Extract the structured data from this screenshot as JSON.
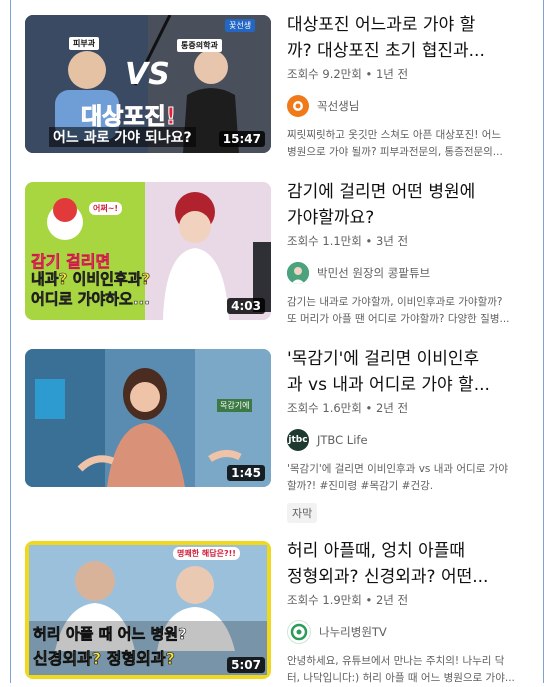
{
  "videos": [
    {
      "title_line1": "대상포진 어느과로 가야 할",
      "title_line2": "까? 대상포진 초기 협진과...",
      "views": "조회수 9.2만회",
      "age": "1년 전",
      "channel": "꼭선생님",
      "desc_line1": "찌릿찌릿하고 옷깃만 스쳐도 아픈 대상포진! 어느",
      "desc_line2": "병원으로 가야 될까? 피부과전문의, 통증전문의...",
      "duration": "15:47",
      "thumb_tag_left": "피부과",
      "thumb_tag_right": "통증의학과",
      "thumb_corner": "꽃선생",
      "thumb_vs": "VS",
      "thumb_big": "대상포진!",
      "thumb_sub": "어느 과로 가야 되나요?",
      "avatar_color": "#f07a1a"
    },
    {
      "title_line1": "감기에 걸리면 어떤 병원에",
      "title_line2": "가야할까요?",
      "views": "조회수 1.1만회",
      "age": "3년 전",
      "channel": "박민선 원장의 콩팥튜브",
      "desc_line1": "감기는 내과로 가야할까, 이비인후과로 가야할까?",
      "desc_line2": "또 머리가 아플 땐 어디로 가야할까? 다양한 질병...",
      "duration": "4:03",
      "thumb_bubble": "어쩌~!",
      "thumb_line1": "감기 걸리면",
      "thumb_line2": "내과? 이비인후과?",
      "thumb_line3": "어디로 가야하오...",
      "avatar_color": "#3b8f6a"
    },
    {
      "title_line1": "'목감기'에 걸리면 이비인후",
      "title_line2": "과 vs 내과 어디로 가야 할...",
      "views": "조회수 1.6만회",
      "age": "2년 전",
      "channel": "JTBC Life",
      "desc_line1": "'목감기'에 걸리면 이비인후과 vs 내과 어디로 가야",
      "desc_line2": "할까?! #진미령 #목감기 #건강.",
      "badge": "자막",
      "duration": "1:45",
      "thumb_caption": "목감기에",
      "avatar_text": "jtbc",
      "avatar_color": "#1e3a2f"
    },
    {
      "title_line1": "허리 아플때, 엉치 아플때",
      "title_line2": "정형외과? 신경외과? 어떤...",
      "views": "조회수 1.9만회",
      "age": "2년 전",
      "channel": "나누리병원TV",
      "desc_line1": "안녕하세요, 유튜브에서 만나는 주치의! 나누리 닥",
      "desc_line2": "터, 나닥입니다:) 허리 아플 때 어느 병원으로 가야...",
      "duration": "5:07",
      "thumb_top": "명쾌한 해답은?!!",
      "thumb_line1": "허리 아플 때 어느 병원?",
      "thumb_line2": "신경외과? 정형외과?",
      "avatar_color": "#2e9b5a"
    }
  ],
  "views_sep": "•"
}
